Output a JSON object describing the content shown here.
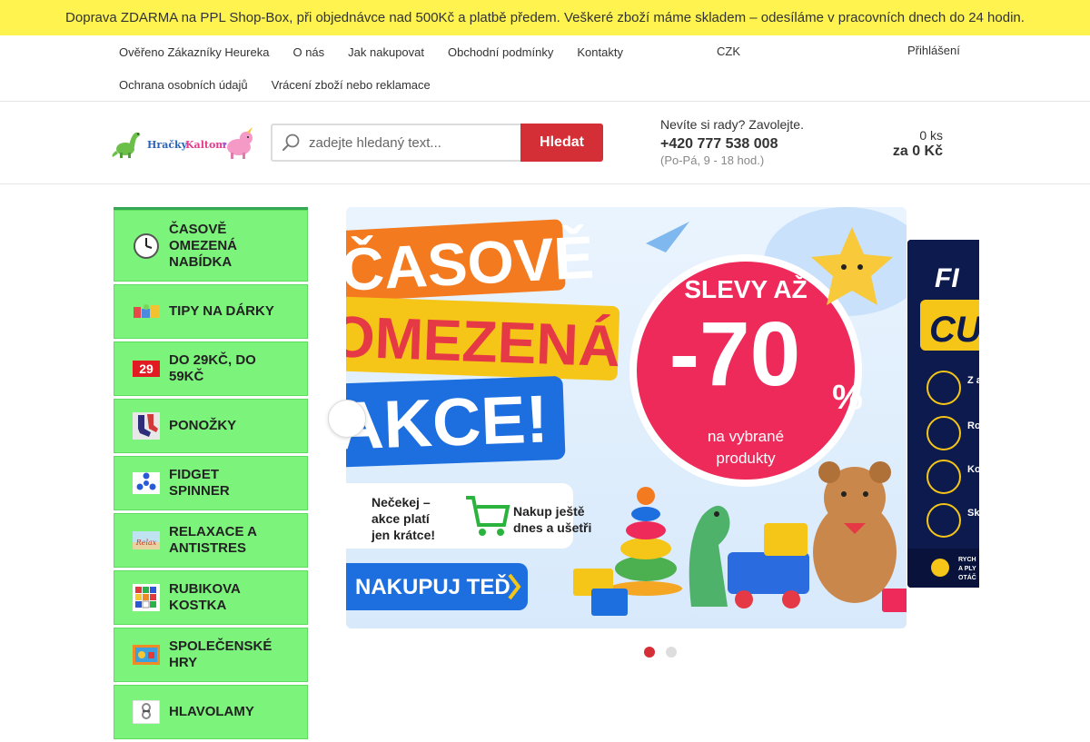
{
  "announcement": {
    "icon_left": "",
    "text": "Doprava ZDARMA na PPL Shop-Box, při objednávce nad 500Kč a platbě předem. Veškeré zboží máme skladem – odesíláme v pracovních dnech do 24 hodin.",
    "icon_mid": "",
    "icon_right": "",
    "close": ""
  },
  "nav": {
    "row1": [
      "Ověřeno Zákazníky Heureka",
      "O nás",
      "Jak nakupovat",
      "Obchodní podmínky",
      "Kontakty"
    ],
    "row2": [
      "Ochrana osobních údajů",
      "Vrácení zboží nebo reklamace"
    ],
    "currency": "CZK",
    "currency_caret": "",
    "icon": "",
    "login_icon": "",
    "login": "Přihlášení"
  },
  "header": {
    "search_placeholder": "zadejte hledaný text...",
    "search_button": "Hledat",
    "contact_question": "Nevíte si rady? Zavolejte.",
    "phone": "+420 777 538 008",
    "hours": "(Po-Pá, 9 - 18 hod.)",
    "phone_icon": "",
    "cart_icon": "",
    "cart_qty": "0 ks",
    "cart_total": "za 0 Kč"
  },
  "categories": [
    {
      "label": "ČASOVĚ OMEZENÁ NABÍDKA",
      "thumb": "clock-icon",
      "arrow": ""
    },
    {
      "label": "TIPY NA DÁRKY",
      "thumb": "gift-toys-icon",
      "arrow": ""
    },
    {
      "label": "DO 29Kč, DO 59Kč",
      "thumb": "price-29-icon",
      "thumb_text": "29",
      "arrow": ""
    },
    {
      "label": "PONOŽKY",
      "thumb": "socks-icon",
      "arrow": ""
    },
    {
      "label": "FIDGET SPINNER",
      "thumb": "spinner-icon",
      "arrow": ""
    },
    {
      "label": "RELAXACE A ANTISTRES",
      "thumb": "relax-icon",
      "thumb_text": "Relax",
      "arrow": ""
    },
    {
      "label": "RUBIKOVA KOSTKA",
      "thumb": "rubik-cube-icon",
      "arrow": ""
    },
    {
      "label": "SPOLEČENSKÉ HRY",
      "thumb": "board-game-icon",
      "arrow": ""
    },
    {
      "label": "HLAVOLAMY",
      "thumb": "puzzle-icon",
      "arrow": ""
    }
  ],
  "slider": {
    "prev_glyph": "",
    "banner_title_1": "ČASOVĚ",
    "banner_title_2": "OMEZENÁ",
    "banner_title_3": "AKCE!",
    "badge_top": "SLEVY AŽ",
    "badge_value": "-70",
    "badge_pct": "%",
    "badge_note_1": "na vybrané",
    "badge_note_2": "produkty",
    "note1_1": "Nečekej –",
    "note1_2": "akce platí",
    "note1_3": "jen krátce!",
    "note2_1": "Nakup ještě",
    "note2_2": "dnes a ušetři",
    "cta": "NAKUPUJ TEĎ",
    "next_title_1": "FI",
    "next_title_2": "CU",
    "next_rows": [
      "Z a h",
      "Ro so a r",
      "Ko a l do",
      "Sk da ka"
    ],
    "next_footer_1": "RYCH",
    "next_footer_2": "A PLY",
    "next_footer_3": "OTÁČ",
    "active_dot": 0,
    "dot_count": 2
  },
  "colors": {
    "topbar": "#fff44f",
    "accent_red": "#d42f36",
    "category_green": "#7cf47c",
    "cart_green": "#2ab43e"
  }
}
